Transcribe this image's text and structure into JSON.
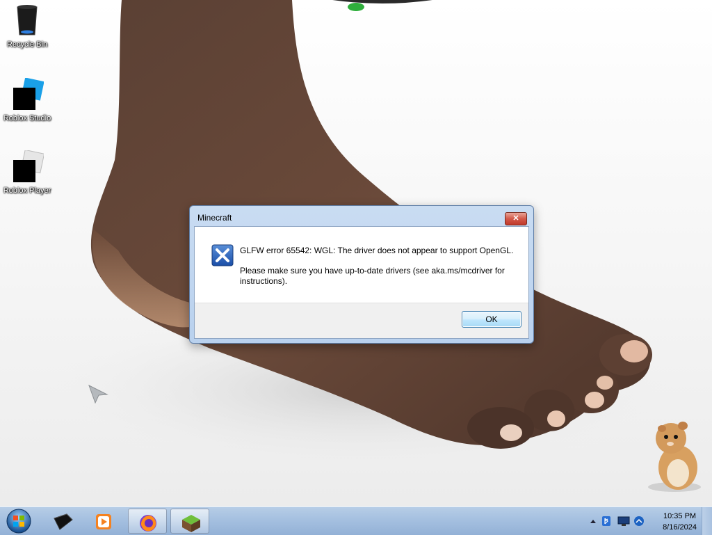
{
  "desktop": {
    "icons": [
      {
        "label": "Recycle Bin"
      },
      {
        "label": "Roblox Studio"
      },
      {
        "label": "Roblox Player"
      }
    ]
  },
  "dialog": {
    "title": "Minecraft",
    "close_glyph": "✕",
    "message_line1": "GLFW error 65542: WGL: The driver does not appear to support OpenGL.",
    "message_line2": "Please make sure you have up-to-date drivers (see aka.ms/mcdriver for instructions).",
    "ok_label": "OK",
    "icon": "error-x-icon"
  },
  "taskbar": {
    "pinned": [
      {
        "icon": "roblox-studio-icon"
      },
      {
        "icon": "media-player-icon"
      },
      {
        "icon": "firefox-icon"
      },
      {
        "icon": "minecraft-icon"
      }
    ],
    "tray": {
      "time": "10:35 PM",
      "date": "8/16/2024"
    }
  },
  "colors": {
    "accent": "#3c7fb1",
    "close_red": "#c1392a",
    "taskbar": "#a5c0e0"
  }
}
